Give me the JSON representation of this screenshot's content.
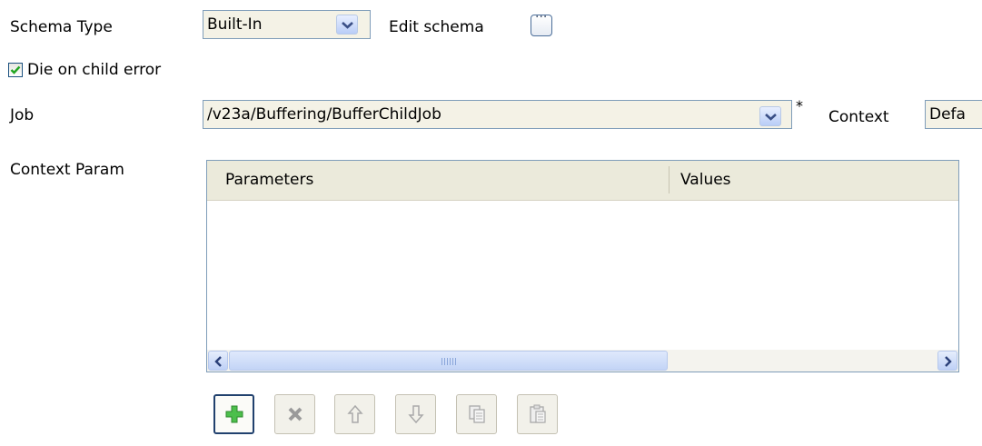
{
  "schema": {
    "label": "Schema Type",
    "value": "Built-In",
    "edit_label": "Edit schema",
    "edit_button_text": "···"
  },
  "die_on_error": {
    "label": "Die on child error",
    "checked": true
  },
  "job": {
    "label": "Job",
    "value": "/v23a/Buffering/BufferChildJob",
    "required_marker": "*"
  },
  "context": {
    "label": "Context",
    "value": "Defa"
  },
  "context_param": {
    "label": "Context Param",
    "columns": [
      "Parameters",
      "Values"
    ],
    "scrollbar_grip": "||||"
  },
  "toolbar": {
    "buttons": [
      {
        "icon": "add-icon",
        "enabled": true
      },
      {
        "icon": "delete-icon",
        "enabled": false
      },
      {
        "icon": "move-up-icon",
        "enabled": false
      },
      {
        "icon": "move-down-icon",
        "enabled": false
      },
      {
        "icon": "copy-icon",
        "enabled": false
      },
      {
        "icon": "paste-icon",
        "enabled": false
      }
    ]
  },
  "colors": {
    "accent": "#21416e",
    "check": "#22a622",
    "add": "#3aa63a",
    "disabled": "#a9a9a9"
  }
}
